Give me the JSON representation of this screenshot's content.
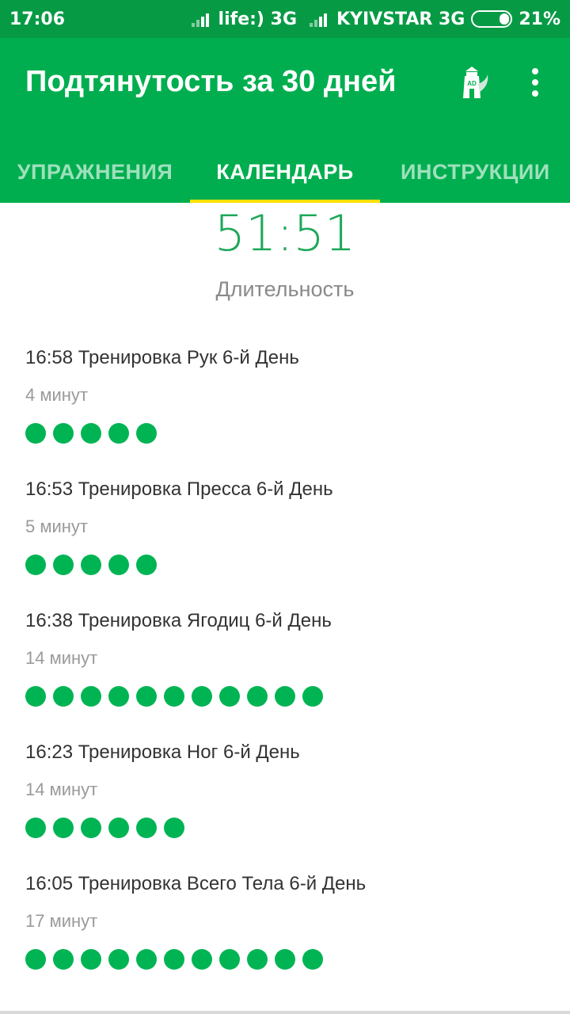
{
  "status_bar": {
    "time": "17:06",
    "carrier1": "life:) 3G",
    "carrier2": "KYIVSTAR 3G",
    "battery": "21%",
    "battery_level": 0.21
  },
  "app_bar": {
    "title": "Подтянутость за 30 дней",
    "icons": [
      "ad-tower-icon",
      "more-vert-icon"
    ]
  },
  "tabs": [
    {
      "label": "УПРАЖНЕНИЯ",
      "active": false
    },
    {
      "label": "КАЛЕНДАРЬ",
      "active": true
    },
    {
      "label": "ИНСТРУКЦИИ",
      "active": false
    }
  ],
  "summary": {
    "time": "51:51",
    "label": "Длительность"
  },
  "workouts": [
    {
      "title": "16:58 Тренировка Рук 6-й День",
      "duration": "4 минут",
      "dots": 5
    },
    {
      "title": "16:53 Тренировка Пресса 6-й День",
      "duration": "5 минут",
      "dots": 5
    },
    {
      "title": "16:38 Тренировка Ягодиц 6-й День",
      "duration": "14 минут",
      "dots": 11
    },
    {
      "title": "16:23 Тренировка Ног 6-й День",
      "duration": "14 минут",
      "dots": 6
    },
    {
      "title": "16:05 Тренировка Всего Тела 6-й День",
      "duration": "17 минут",
      "dots": 11
    }
  ],
  "colors": {
    "status_bar": "#079a45",
    "app_bar": "#00ae4f",
    "accent": "#ffe100",
    "dot": "#00b454",
    "summary_time": "#1ea85a"
  }
}
